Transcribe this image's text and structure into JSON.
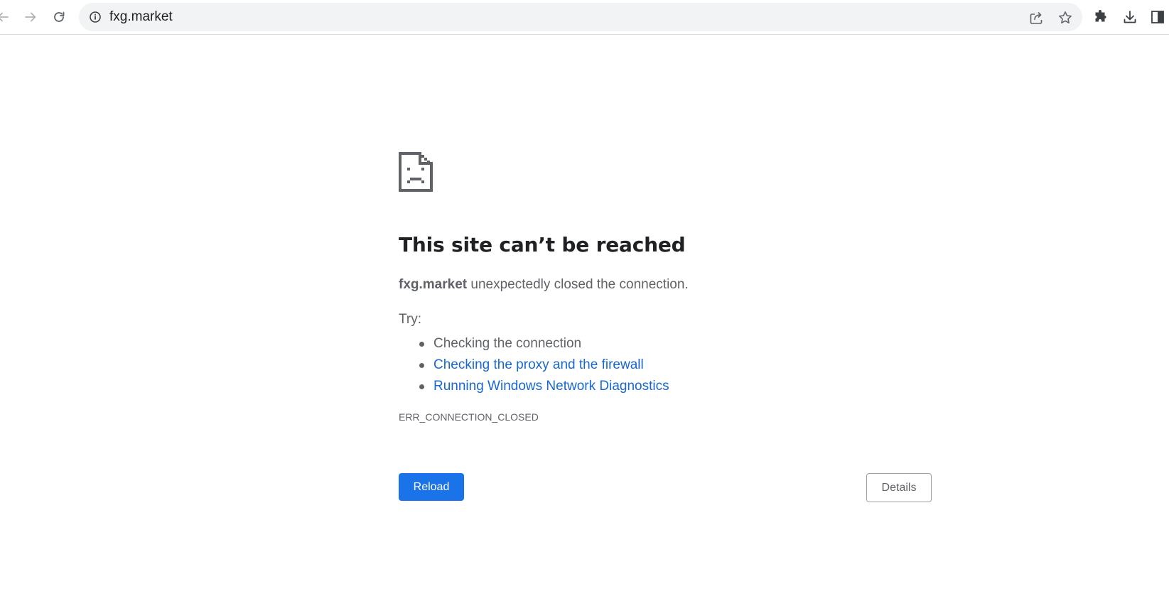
{
  "browser": {
    "url": "fxg.market",
    "icons": {
      "back": "back-arrow-icon",
      "forward": "forward-arrow-icon",
      "reload": "reload-icon",
      "site_info": "info-icon",
      "share": "share-icon",
      "bookmark": "star-icon",
      "extensions": "puzzle-icon",
      "downloads": "download-icon",
      "side_panel": "side-panel-icon"
    }
  },
  "error_page": {
    "icon": "sad-page-icon",
    "heading": "This site can’t be reached",
    "host": "fxg.market",
    "description": " unexpectedly closed the connection.",
    "try_label": "Try:",
    "suggestions": [
      {
        "text": "Checking the connection",
        "is_link": false
      },
      {
        "text": "Checking the proxy and the firewall",
        "is_link": true
      },
      {
        "text": "Running Windows Network Diagnostics",
        "is_link": true
      }
    ],
    "error_code": "ERR_CONNECTION_CLOSED",
    "reload_label": "Reload",
    "details_label": "Details"
  },
  "colors": {
    "primary_button": "#1a73e8",
    "link": "#1967d2",
    "secondary_text": "#5f6368",
    "heading_text": "#202124",
    "omnibox_bg": "#f1f3f4"
  }
}
